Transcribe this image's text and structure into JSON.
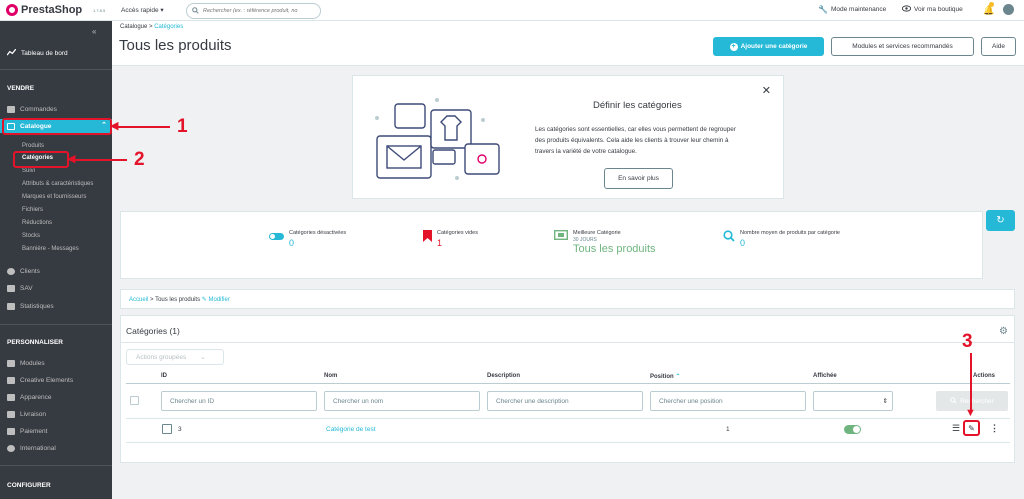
{
  "topbar": {
    "logo": "PrestaShop",
    "version": "1.7.8.5",
    "quick_access": "Accès rapide",
    "search_placeholder": "Rechercher (ex. : référence produit, no",
    "maintenance": "Mode maintenance",
    "view_shop": "Voir ma boutique"
  },
  "sidebar": {
    "dashboard": "Tableau de bord",
    "sell_heading": "VENDRE",
    "orders": "Commandes",
    "catalog": "Catalogue",
    "catalog_sub": [
      "Produits",
      "Catégories",
      "Suivi",
      "Attributs & caractéristiques",
      "Marques et fournisseurs",
      "Fichiers",
      "Réductions",
      "Stocks",
      "Bannière - Messages"
    ],
    "clients": "Clients",
    "sav": "SAV",
    "stats": "Statistiques",
    "customize_heading": "PERSONNALISER",
    "modules": "Modules",
    "creative": "Creative Elements",
    "appearance": "Apparence",
    "delivery": "Livraison",
    "payment": "Paiement",
    "international": "International",
    "configure_heading": "CONFIGURER"
  },
  "header": {
    "breadcrumb_root": "Catalogue",
    "breadcrumb_current": "Catégories",
    "title": "Tous les produits",
    "add_category": "Ajouter une catégorie",
    "modules_services": "Modules et services recommandés",
    "help": "Aide"
  },
  "info": {
    "title": "Définir les catégories",
    "text": "Les catégories sont essentielles, car elles vous permettent de regrouper des produits équivalents. Cela aide les clients à trouver leur chemin à travers la variété de votre catalogue.",
    "button": "En savoir plus"
  },
  "kpis": [
    {
      "label": "Catégories désactivées",
      "sub": "",
      "value": "0"
    },
    {
      "label": "Catégories vides",
      "sub": "",
      "value": "1"
    },
    {
      "label": "Meilleure Catégorie",
      "sub": "30 JOURS",
      "value": "Tous les produits"
    },
    {
      "label": "Nombre moyen de produits par catégorie",
      "sub": "",
      "value": "0"
    }
  ],
  "crumb_card": {
    "home": "Accueil",
    "current": "Tous les produits",
    "edit": "Modifier"
  },
  "table": {
    "title": "Catégories (1)",
    "bulk": "Actions groupées",
    "columns": [
      "ID",
      "Nom",
      "Description",
      "Position",
      "Affichée",
      "Actions"
    ],
    "filters": {
      "id": "Chercher un ID",
      "name": "Chercher un nom",
      "description": "Chercher une description",
      "position": "Chercher une position",
      "search_btn": "Rechercher"
    },
    "rows": [
      {
        "id": "3",
        "name": "Catégorie de test",
        "description": "",
        "position": "1",
        "displayed": true
      }
    ]
  },
  "annotations": [
    "1",
    "2",
    "3"
  ],
  "colors": {
    "accent": "#25b9d7",
    "sidebar": "#363a41",
    "annotation": "#e3132a",
    "success": "#70b580"
  }
}
